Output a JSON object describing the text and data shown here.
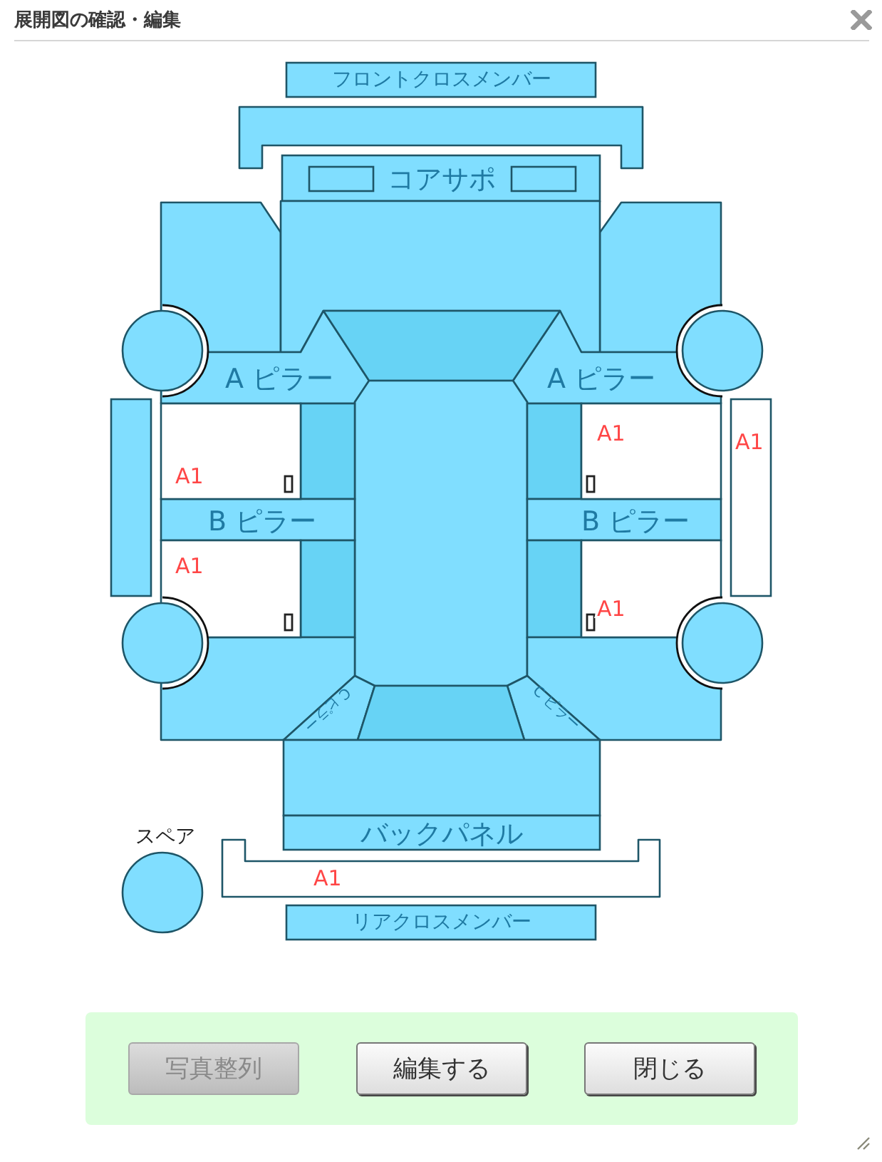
{
  "window": {
    "title": "展開図の確認・編集"
  },
  "diagram": {
    "part_labels": [
      "フロントクロスメンバー",
      "コアサポ",
      "A ピラー",
      "A ピラー",
      "B ピラー",
      "B ピラー",
      "C ピラー",
      "C ピラー",
      "バックパネル",
      "スペア",
      "リアクロスメンバー"
    ],
    "damage_codes": [
      "A1",
      "A1",
      "A1",
      "A1",
      "A1",
      "A1"
    ]
  },
  "buttons": [
    {
      "label": "写真整列",
      "disabled": true
    },
    {
      "label": "編集する",
      "disabled": false
    },
    {
      "label": "閉じる",
      "disabled": false
    }
  ]
}
